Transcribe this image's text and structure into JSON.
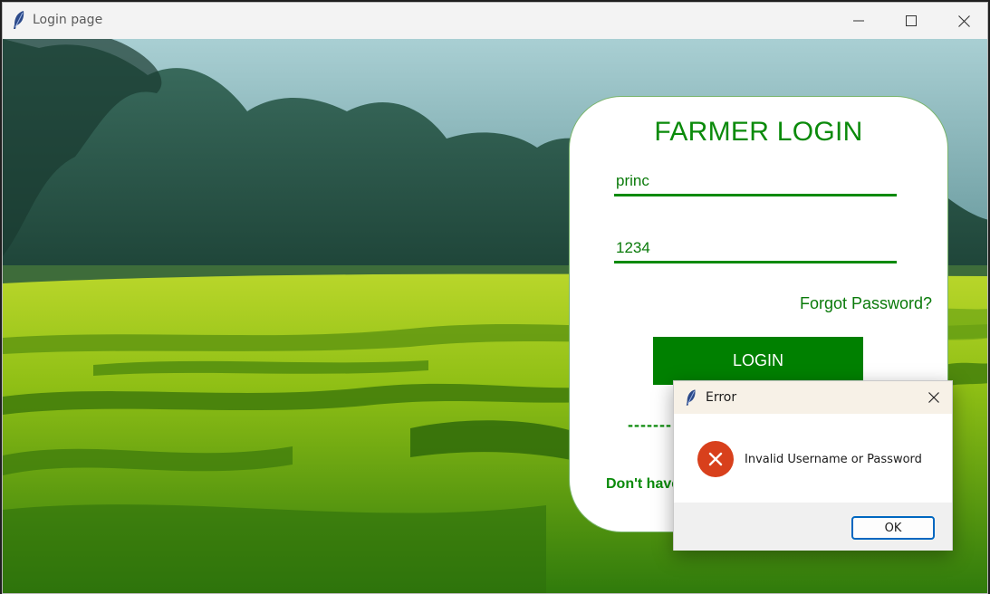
{
  "window": {
    "title": "Login page",
    "icon": "feather-icon"
  },
  "login_card": {
    "heading": "FARMER LOGIN",
    "username_value": "princ",
    "password_value": "1234",
    "forgot_label": "Forgot Password?",
    "login_label": "LOGIN",
    "divider": "-------",
    "signup_prompt": "Don't have"
  },
  "dialog": {
    "title": "Error",
    "message": "Invalid Username or Password",
    "ok_label": "OK",
    "icon": "error-icon"
  },
  "colors": {
    "accent_green": "#008000",
    "text_green": "#0a8a0a",
    "error_red": "#d8401c",
    "dialog_button_border": "#0067c0"
  }
}
